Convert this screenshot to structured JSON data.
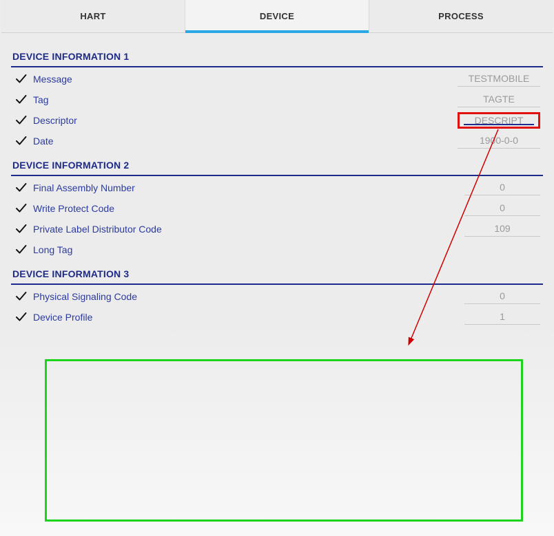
{
  "tabs": {
    "hart": "HART",
    "device": "DEVICE",
    "process": "PROCESS"
  },
  "sections": [
    {
      "title": "DEVICE INFORMATION 1",
      "rows": [
        {
          "label": "Message",
          "value": "TESTMOBILE"
        },
        {
          "label": "Tag",
          "value": "TAGTE"
        },
        {
          "label": "Descriptor",
          "value": "DESCRIPT",
          "highlight": true
        },
        {
          "label": "Date",
          "value": "1900-0-0"
        }
      ]
    },
    {
      "title": "DEVICE INFORMATION 2",
      "rows": [
        {
          "label": "Final Assembly Number",
          "value": "0"
        },
        {
          "label": "Write Protect Code",
          "value": "0"
        },
        {
          "label": "Private Label Distributor Code",
          "value": "109"
        },
        {
          "label": "Long Tag",
          "value": ""
        }
      ]
    },
    {
      "title": "DEVICE INFORMATION 3",
      "rows": [
        {
          "label": "Physical Signaling Code",
          "value": "0"
        },
        {
          "label": "Device Profile",
          "value": "1"
        }
      ]
    }
  ]
}
